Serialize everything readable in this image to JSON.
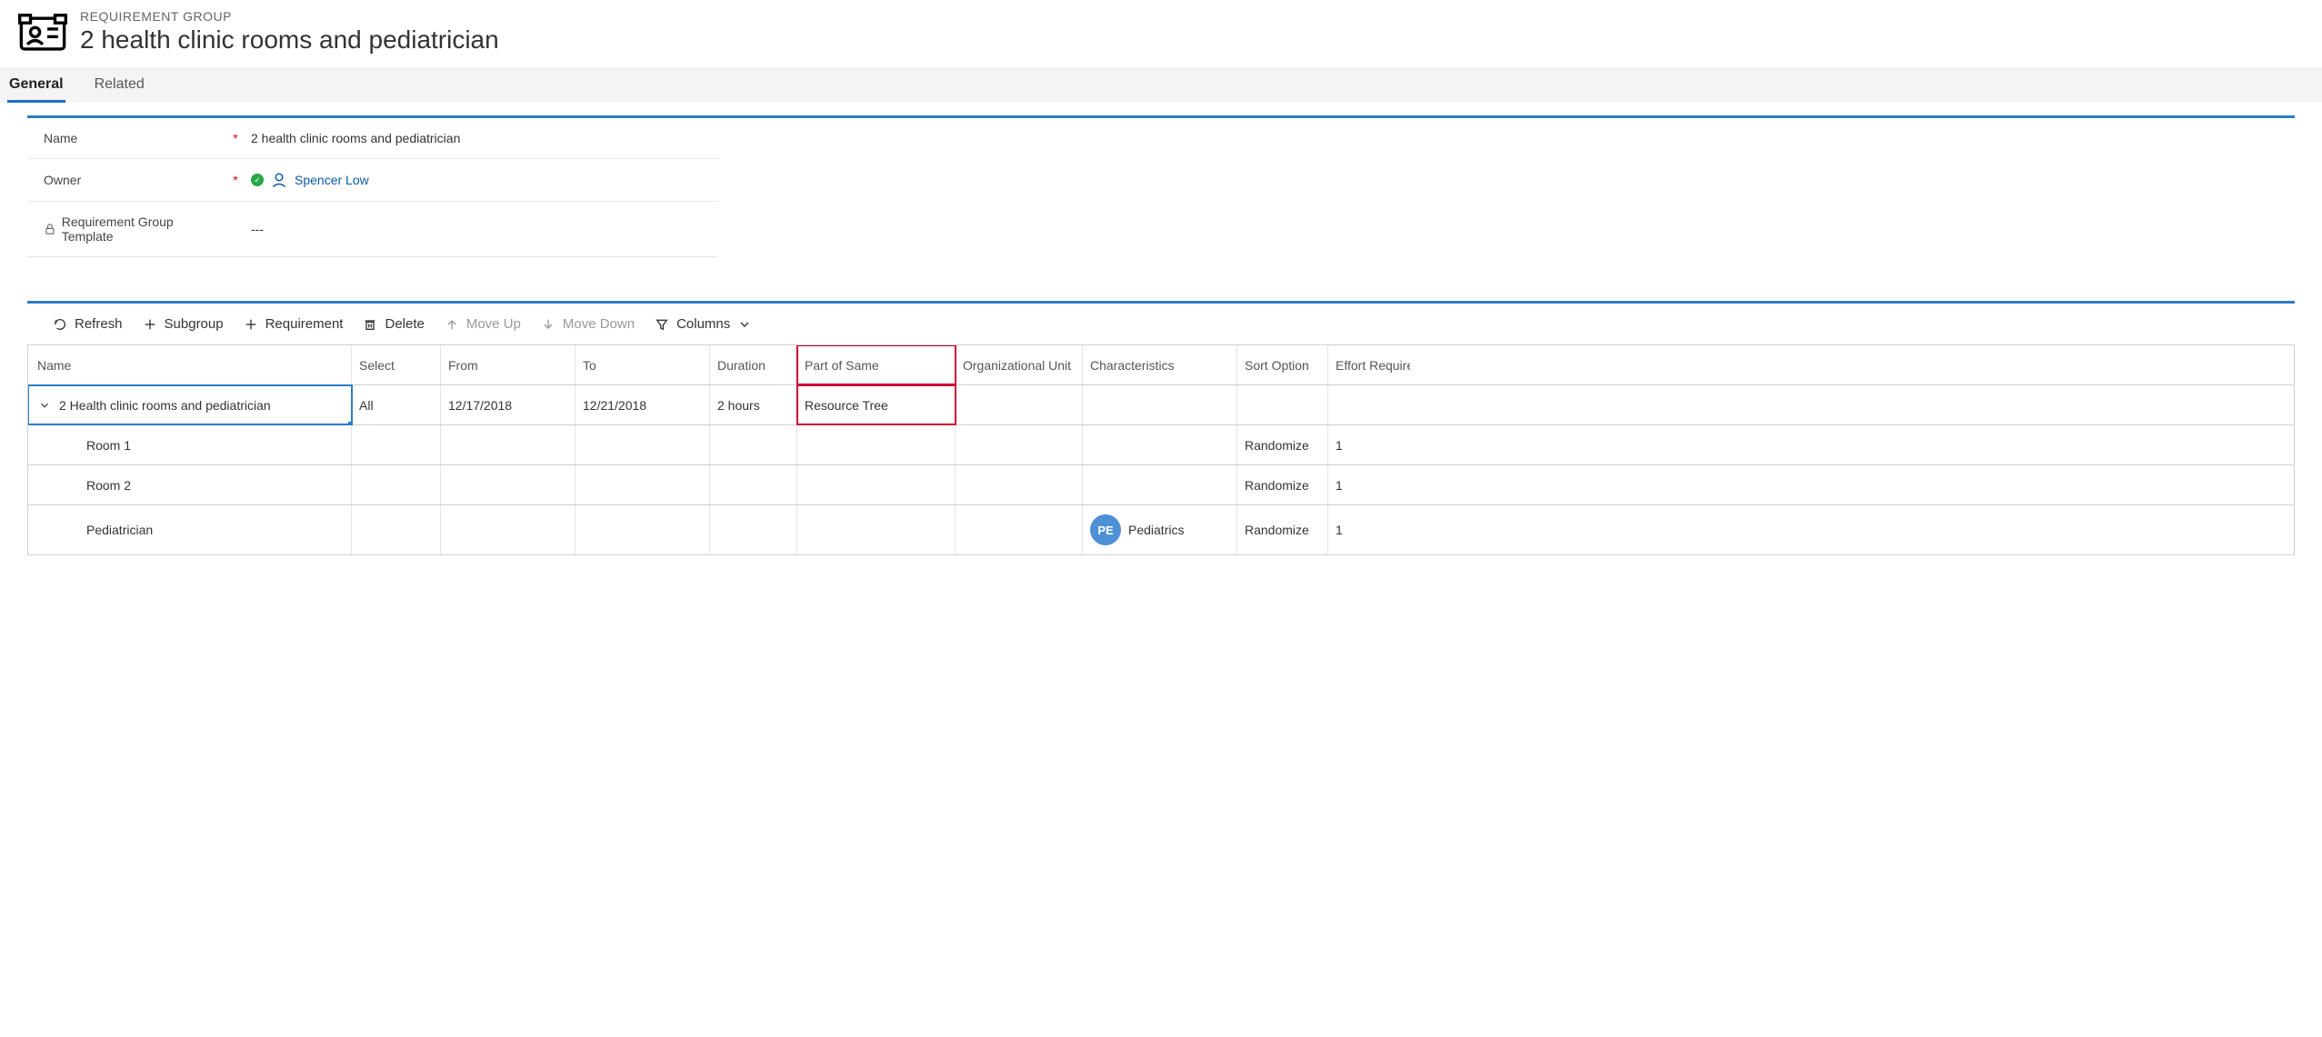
{
  "header": {
    "entity_label": "REQUIREMENT GROUP",
    "title": "2 health clinic rooms and pediatrician"
  },
  "tabs": [
    {
      "label": "General",
      "active": true
    },
    {
      "label": "Related",
      "active": false
    }
  ],
  "form": {
    "name_label": "Name",
    "name_value": "2 health clinic rooms and pediatrician",
    "owner_label": "Owner",
    "owner_value": "Spencer Low",
    "template_label": "Requirement Group Template",
    "template_value": "---"
  },
  "toolbar": {
    "refresh": "Refresh",
    "subgroup": "Subgroup",
    "requirement": "Requirement",
    "delete": "Delete",
    "moveup": "Move Up",
    "movedown": "Move Down",
    "columns": "Columns"
  },
  "grid": {
    "headers": {
      "name": "Name",
      "select": "Select",
      "from": "From",
      "to": "To",
      "duration": "Duration",
      "part_of_same": "Part of Same",
      "org_unit": "Organizational Unit",
      "characteristics": "Characteristics",
      "sort_option": "Sort Option",
      "effort_required": "Effort Require"
    },
    "rows": [
      {
        "name": "2 Health clinic rooms and pediatrician",
        "select": "All",
        "from": "12/17/2018",
        "to": "12/21/2018",
        "duration": "2 hours",
        "part_of_same": "Resource Tree",
        "org_unit": "",
        "char_badge": "",
        "char_text": "",
        "sort_option": "",
        "effort": "",
        "level": 0,
        "expanded": true,
        "selected": true,
        "highlight_partsame": true
      },
      {
        "name": "Room 1",
        "select": "",
        "from": "",
        "to": "",
        "duration": "",
        "part_of_same": "",
        "org_unit": "",
        "char_badge": "",
        "char_text": "",
        "sort_option": "Randomize",
        "effort": "1",
        "level": 1
      },
      {
        "name": "Room 2",
        "select": "",
        "from": "",
        "to": "",
        "duration": "",
        "part_of_same": "",
        "org_unit": "",
        "char_badge": "",
        "char_text": "",
        "sort_option": "Randomize",
        "effort": "1",
        "level": 1
      },
      {
        "name": "Pediatrician",
        "select": "",
        "from": "",
        "to": "",
        "duration": "",
        "part_of_same": "",
        "org_unit": "",
        "char_badge": "PE",
        "char_text": "Pediatrics",
        "sort_option": "Randomize",
        "effort": "1",
        "level": 1
      }
    ]
  }
}
